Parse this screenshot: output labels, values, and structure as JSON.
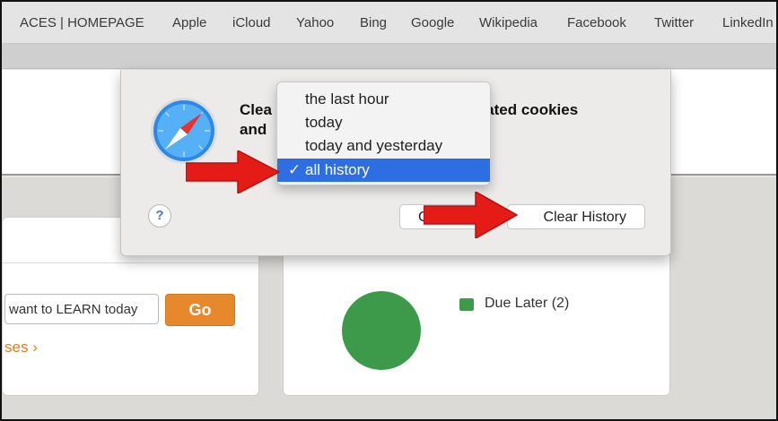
{
  "favorites": [
    "ACES | HOMEPAGE",
    "Apple",
    "iCloud",
    "Yahoo",
    "Bing",
    "Google",
    "Wikipedia",
    "Facebook",
    "Twitter",
    "LinkedIn"
  ],
  "dialog": {
    "title_left": "Clea",
    "title_left_line2": "and",
    "title_right": "elated cookies",
    "clear_label_fragment": "a",
    "help_label": "?",
    "cancel_fragment": "C",
    "clear_button": "Clear History"
  },
  "dropdown": {
    "options": [
      "the last hour",
      "today",
      "today and yesterday",
      "all history"
    ],
    "selected": "all history",
    "check": "✓"
  },
  "page": {
    "search_placeholder": "want to LEARN today",
    "go_button": "Go",
    "courses_link": "ses",
    "legend_label": "Due Later (2)"
  },
  "chart_data": {
    "type": "pie",
    "categories": [
      "Due Later"
    ],
    "values": [
      2
    ],
    "colors": [
      "#3e9a4b"
    ]
  },
  "colors": {
    "accent_orange": "#e8882c",
    "selection_blue": "#2d6fe2",
    "arrow_red": "#e41b17",
    "pie_green": "#3e9a4b"
  }
}
